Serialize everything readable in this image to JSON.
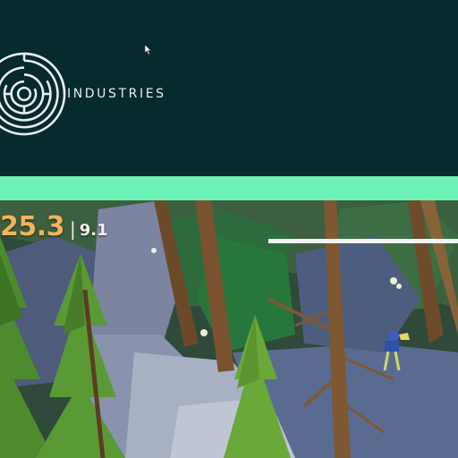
{
  "banner": {
    "brand_text": "INDUSTRIES",
    "background_color": "#062a2e",
    "logo_icon": "concentric-maze-logo-icon"
  },
  "accent_bar": {
    "color": "#6df2b8"
  },
  "hud": {
    "time_primary": "25.3",
    "separator": "|",
    "time_secondary": "9.1",
    "primary_color": "#f2b35a",
    "secondary_color": "#f0f0f0"
  },
  "cursor": {
    "icon": "mouse-pointer-icon"
  }
}
